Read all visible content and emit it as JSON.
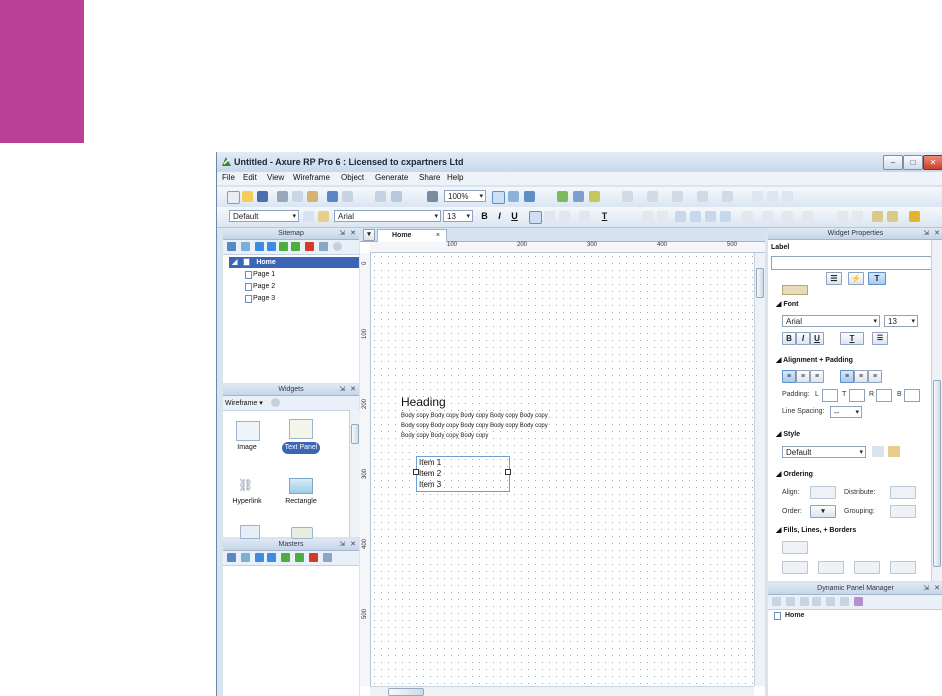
{
  "window": {
    "title": "Untitled - Axure RP Pro 6 : Licensed to cxpartners Ltd",
    "controls": {
      "minimize": "–",
      "maximize": "□",
      "close": "✕"
    }
  },
  "menu": [
    "File",
    "Edit",
    "View",
    "Wireframe",
    "Object",
    "Generate",
    "Share",
    "Help"
  ],
  "toolbar": {
    "zoom": "100%",
    "style": "Default",
    "font": "Arial",
    "font_size": "13",
    "bold": "B",
    "italic": "I",
    "underline": "U",
    "text_color": "T"
  },
  "sitemap": {
    "title": "Sitemap",
    "root": "Home",
    "pages": [
      "Page 1",
      "Page 2",
      "Page 3"
    ]
  },
  "widgets": {
    "title": "Widgets",
    "library": "Wireframe",
    "items": [
      "Image",
      "Text Panel",
      "Hyperlink",
      "Rectangle"
    ],
    "selected": "Text Panel"
  },
  "masters": {
    "title": "Masters"
  },
  "canvas": {
    "tab": "Home",
    "tab_close": "×",
    "ruler_h": [
      "100",
      "200",
      "300",
      "400",
      "500"
    ],
    "ruler_v": [
      "0",
      "100",
      "200",
      "300",
      "400",
      "500"
    ],
    "heading": "Heading",
    "body_copy": "Body copy Body copy Body copy Body copy Body copy Body copy Body copy Body copy Body copy Body copy Body copy Body copy Body copy",
    "list_items": [
      "Item 1",
      "Item 2",
      "Item 3"
    ]
  },
  "widget_properties": {
    "title": "Widget Properties",
    "label_heading": "Label",
    "label_value": "",
    "font_section": "Font",
    "font": "Arial",
    "font_size": "13",
    "alignment_section": "Alignment + Padding",
    "padding_label": "Padding:",
    "padding_sides": [
      "L",
      "T",
      "R",
      "B"
    ],
    "line_spacing_label": "Line Spacing:",
    "line_spacing_value": "--",
    "style_section": "Style",
    "style_value": "Default",
    "ordering_section": "Ordering",
    "align_label": "Align:",
    "distribute_label": "Distribute:",
    "order_label": "Order:",
    "grouping_label": "Grouping:",
    "fills_section": "Fills, Lines, + Borders"
  },
  "dynamic_panel_manager": {
    "title": "Dynamic Panel Manager",
    "root": "Home"
  },
  "colors": {
    "brand": "#bb3f96",
    "selection": "#3b66b5",
    "frame": "#d8e4f0"
  }
}
